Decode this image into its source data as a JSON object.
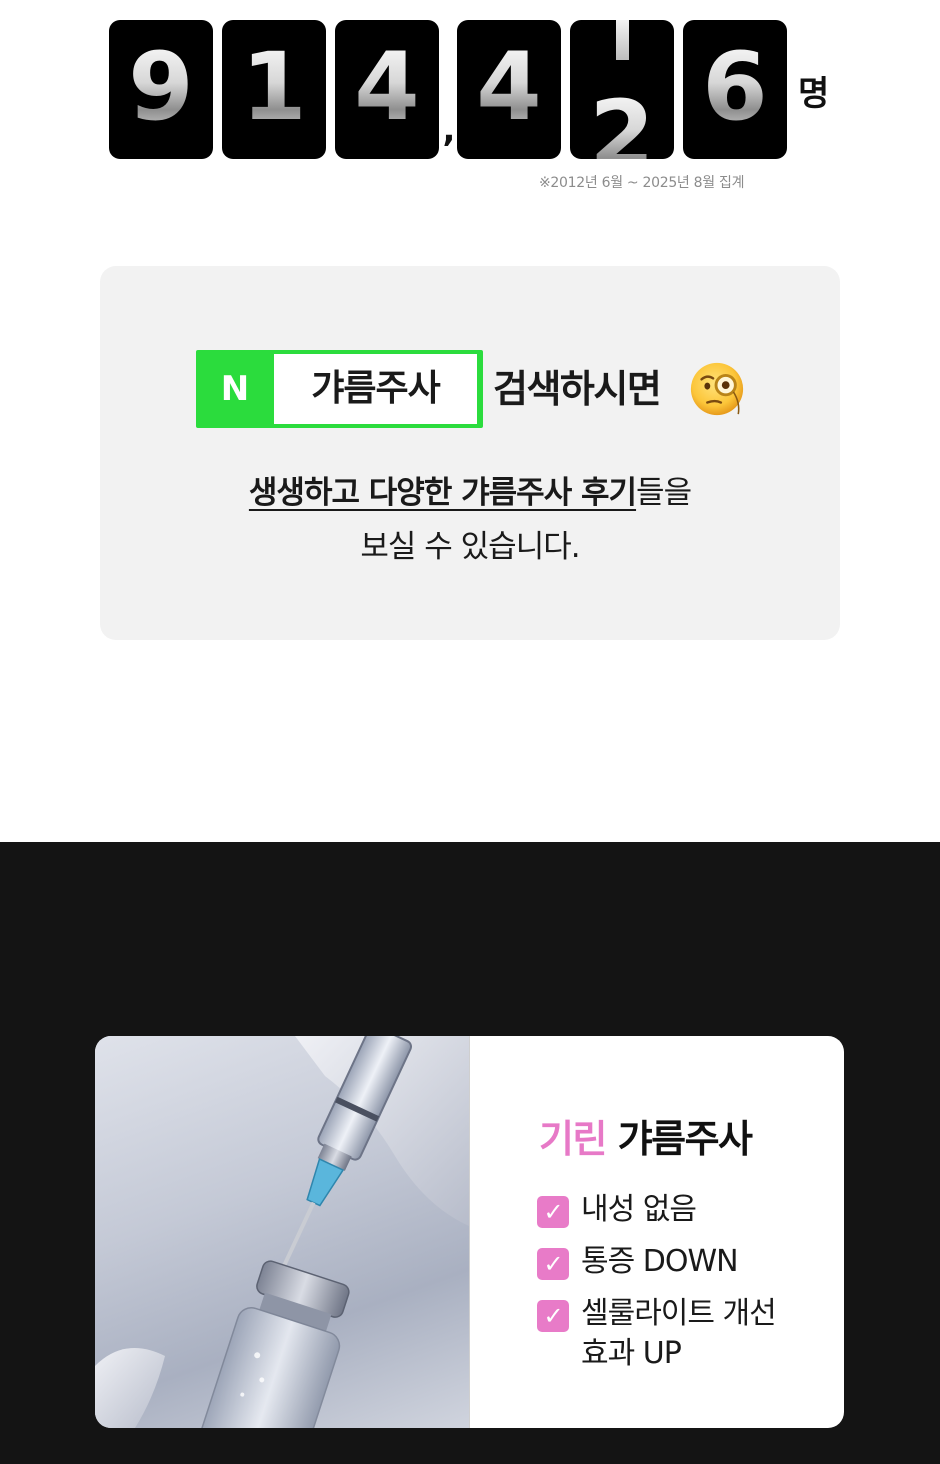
{
  "counter": {
    "digits": [
      "9",
      "1",
      "4",
      "4",
      "2",
      "6"
    ],
    "separator": ",",
    "unit": "명",
    "period_note": "※2012년 6월 ~ 2025년 8월 집계"
  },
  "search": {
    "naver_logo": "N",
    "keyword": "갸름주사",
    "suffix": "검색하시면",
    "emoji": "face-with-monocle",
    "description": {
      "highlight": "생생하고 다양한 갸름주사 후기",
      "after_highlight": "들을",
      "line2": "보실 수 있습니다."
    }
  },
  "product": {
    "brand": "기린",
    "name": "갸름주사",
    "features": [
      "내성 없음",
      "통증 DOWN",
      "셀룰라이트 개선",
      "효과 UP"
    ],
    "check_icon": "✓",
    "image": "syringe-and-vial-photo"
  },
  "colors": {
    "naver_green": "#2bdc3d",
    "brand_pink": "#e779c7",
    "dark_bg": "#141414",
    "card_bg": "#f2f2f2"
  }
}
